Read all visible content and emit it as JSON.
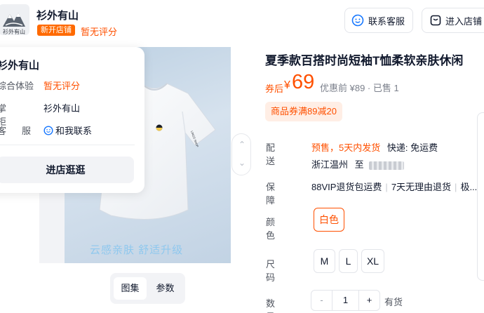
{
  "shop": {
    "name": "衫外有山",
    "logo_text": "衫外有山",
    "badge": "新开店铺",
    "rating": "暂无评分",
    "service_button": "联系客服",
    "enter_shop_button": "进入店铺"
  },
  "shop_popup": {
    "title": "衫外有山",
    "rows": [
      {
        "label": "综合体验",
        "value": "暂无评分"
      },
      {
        "label": "掌柜",
        "value": "衫外有山"
      },
      {
        "label": "客服",
        "value": "和我联系"
      }
    ],
    "button": "进店逛逛"
  },
  "gallery": {
    "slogan": "云感亲肤 舒适升级",
    "print_text": "LINGS SHOP",
    "tabs": [
      "图集",
      "参数"
    ],
    "active_tab": "图集"
  },
  "product": {
    "title": "夏季款百搭时尚短袖T恤柔软亲肤休闲",
    "price_label": "券后",
    "currency": "¥",
    "price": "69",
    "original_price": "优惠前 ¥89 · 已售 1",
    "coupon": "商品券满89减20",
    "accent_color": "#ff5000"
  },
  "delivery": {
    "label": "配送",
    "presale": "预售，5天内发货",
    "shipping": "快递: 免运费",
    "origin": "浙江温州",
    "to": "至"
  },
  "guarantee": {
    "label": "保障",
    "items": [
      "88VIP退货包运费",
      "7天无理由退货",
      "极..."
    ]
  },
  "color": {
    "label": "颜色",
    "options": [
      "白色"
    ],
    "selected": "白色"
  },
  "size": {
    "label": "尺码",
    "options": [
      "M",
      "L",
      "XL"
    ]
  },
  "quantity": {
    "label": "数量",
    "minus": "-",
    "value": "1",
    "plus": "+",
    "stock": "有货"
  }
}
